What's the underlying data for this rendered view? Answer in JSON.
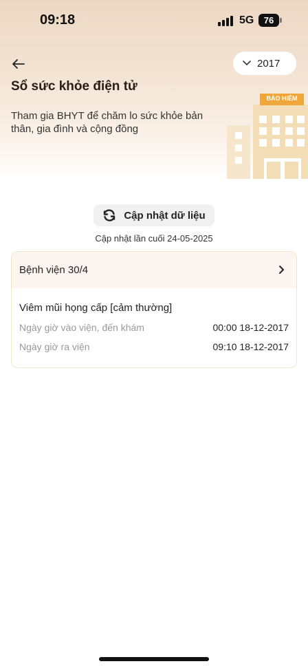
{
  "status_bar": {
    "time": "09:18",
    "network": "5G",
    "battery": "76"
  },
  "header": {
    "year_selected": "2017",
    "title": "Sổ sức khỏe điện tử",
    "subtitle": "Tham gia BHYT để chăm lo sức khỏe bản thân, gia đình và cộng đồng",
    "illustration_sign": "BẢO HIỂM"
  },
  "update": {
    "button_label": "Cập nhật dữ liệu",
    "last_updated": "Cập nhật lần cuối 24-05-2025"
  },
  "record": {
    "hospital": "Bệnh viện 30/4",
    "diagnosis": "Viêm mũi họng cấp [cảm thường]",
    "admission_label": "Ngày giờ vào viện, đến khám",
    "admission_value": "00:00 18-12-2017",
    "discharge_label": "Ngày giờ ra viện",
    "discharge_value": "09:10 18-12-2017"
  },
  "colors": {
    "accent": "#f0a73a",
    "hero_bg": "#ecd7c3",
    "card_border": "#f0e6cc"
  }
}
